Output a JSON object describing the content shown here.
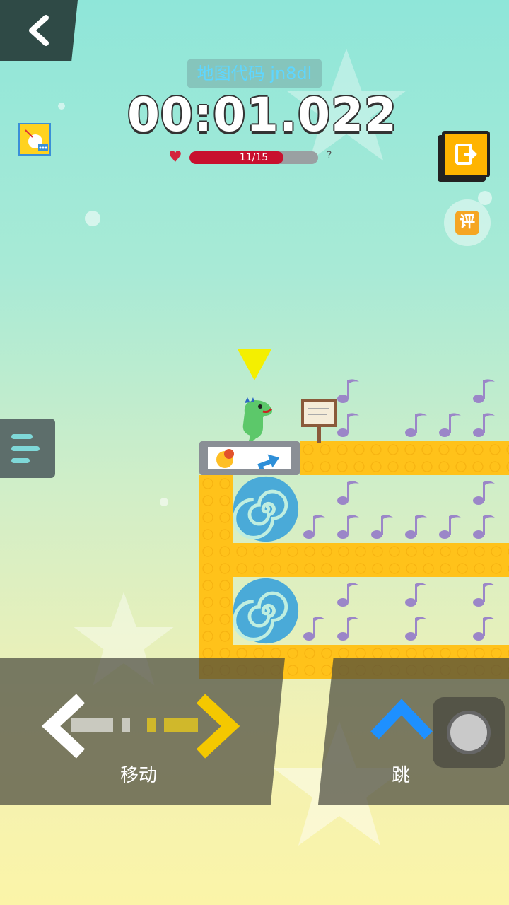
{
  "header": {
    "map_code_label": "地图代码 jn8dl",
    "timer": "00:01.022",
    "health": {
      "text": "11/15",
      "current": 11,
      "max": 15,
      "help": "?"
    }
  },
  "sidebar": {
    "review_label": "评"
  },
  "controls": {
    "move_label": "移动",
    "jump_label": "跳"
  },
  "colors": {
    "accent_yellow": "#ffc21a",
    "health_red": "#c8102e",
    "jump_blue": "#1e90ff",
    "map_code_cyan": "#5fd6ff"
  },
  "icons": {
    "back": "chevron-left-icon",
    "menu": "hamburger-menu-icon",
    "exit": "exit-icon",
    "left_arrow": "left-arrow-icon",
    "right_arrow": "right-arrow-icon",
    "jump_arrow": "up-arrow-icon"
  }
}
